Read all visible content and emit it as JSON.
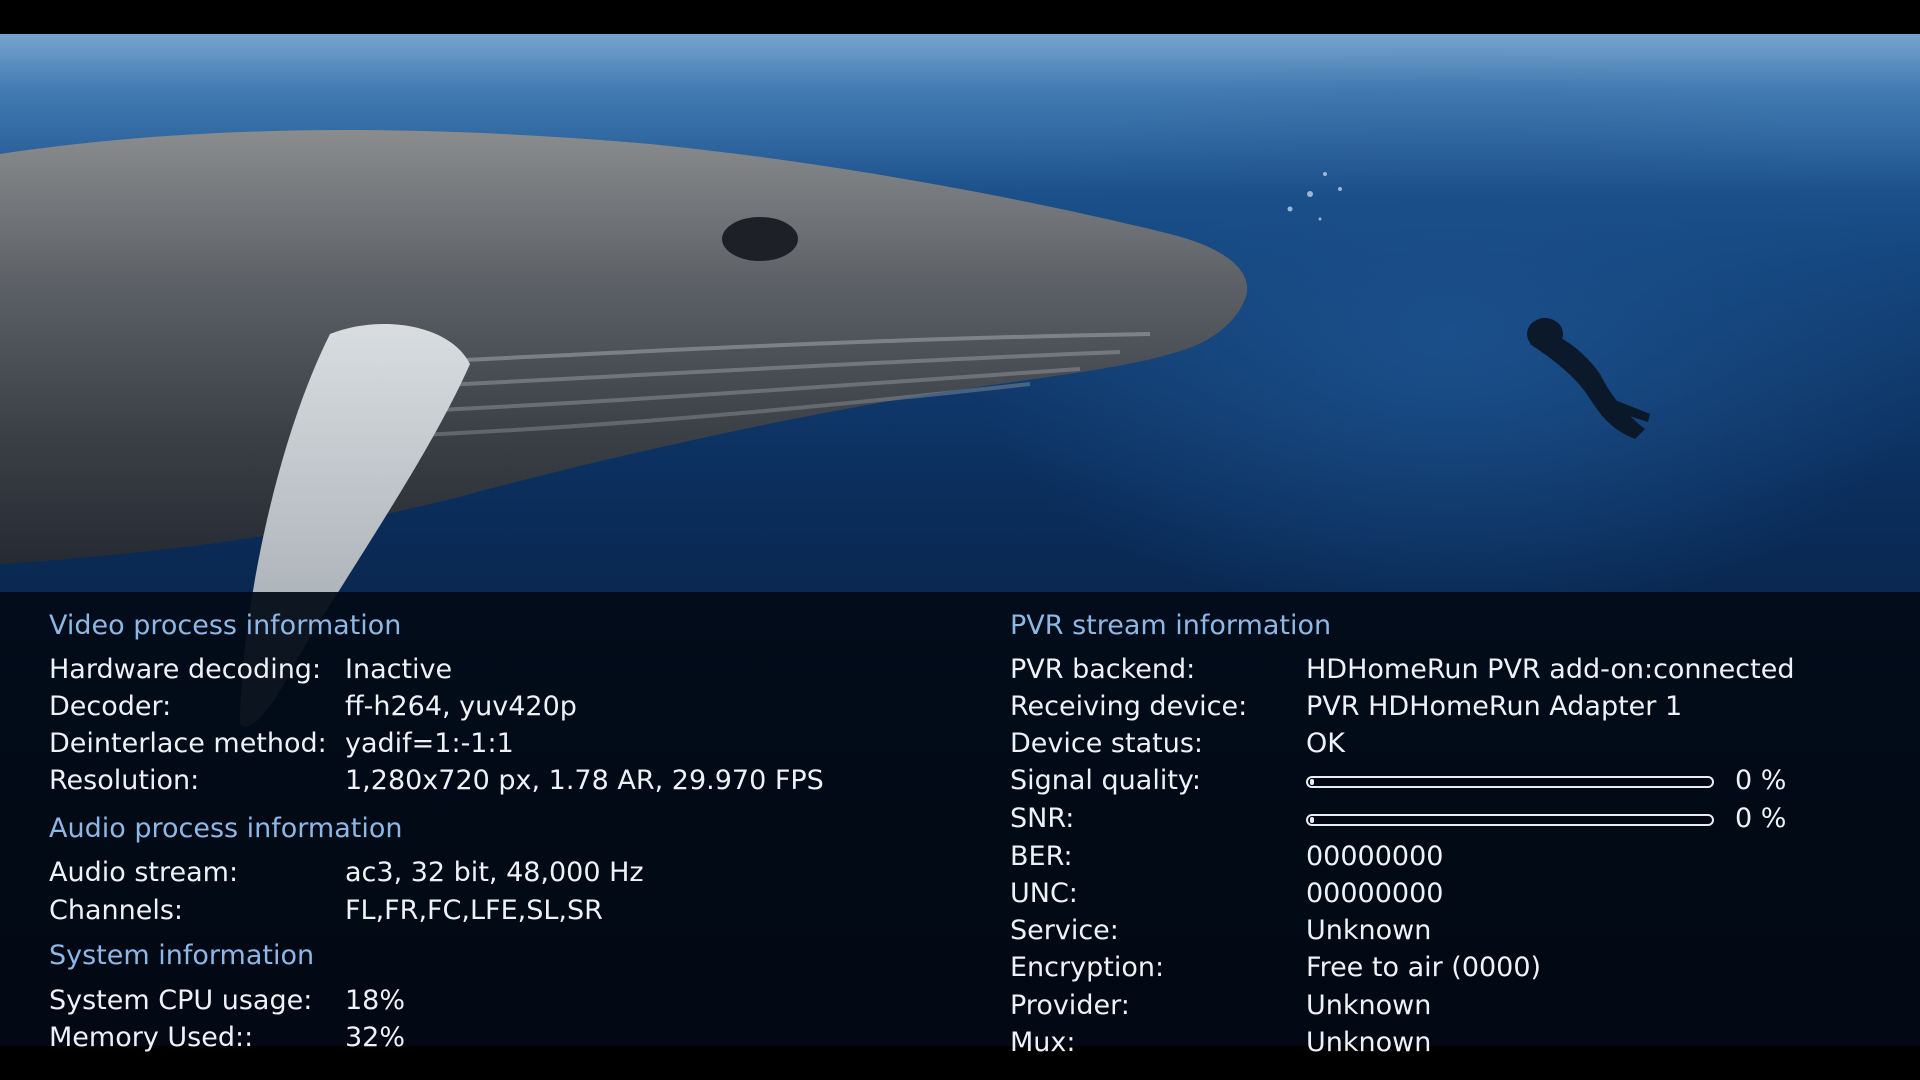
{
  "video": {
    "scene_icon": "humpback-whale-and-diver-underwater-frame"
  },
  "video_process": {
    "title": "Video process information",
    "rows": [
      {
        "label": "Hardware decoding:",
        "value": "Inactive"
      },
      {
        "label": "Decoder:",
        "value": "ff-h264, yuv420p"
      },
      {
        "label": "Deinterlace method:",
        "value": "yadif=1:-1:1"
      },
      {
        "label": "Resolution:",
        "value": "1,280x720 px, 1.78 AR, 29.970 FPS"
      }
    ]
  },
  "audio_process": {
    "title": "Audio process information",
    "rows": [
      {
        "label": "Audio stream:",
        "value": "ac3, 32 bit, 48,000 Hz"
      },
      {
        "label": "Channels:",
        "value": "FL,FR,FC,LFE,SL,SR"
      }
    ]
  },
  "system": {
    "title": "System information",
    "rows": [
      {
        "label": "System CPU usage:",
        "value": "18%"
      },
      {
        "label": "Memory Used::",
        "value": "32%"
      }
    ]
  },
  "pvr": {
    "title": "PVR stream information",
    "rows": [
      {
        "label": "PVR backend:",
        "value": "HDHomeRun PVR add-on:connected"
      },
      {
        "label": "Receiving device:",
        "value": "PVR HDHomeRun Adapter 1"
      },
      {
        "label": "Device status:",
        "value": "OK"
      }
    ],
    "signal_quality": {
      "label": "Signal quality:",
      "percent_text": "0 %",
      "level": 0
    },
    "snr": {
      "label": "SNR:",
      "percent_text": "0 %",
      "level": 0
    },
    "rows2": [
      {
        "label": "BER:",
        "value": "00000000"
      },
      {
        "label": "UNC:",
        "value": "00000000"
      },
      {
        "label": "Service:",
        "value": "Unknown"
      },
      {
        "label": "Encryption:",
        "value": "Free to air (0000)"
      },
      {
        "label": "Provider:",
        "value": "Unknown"
      },
      {
        "label": "Mux:",
        "value": "Unknown"
      }
    ]
  },
  "colors": {
    "section_title": "#8db8e6",
    "text": "#eef2f6",
    "overlay_bg": "#020a16"
  }
}
